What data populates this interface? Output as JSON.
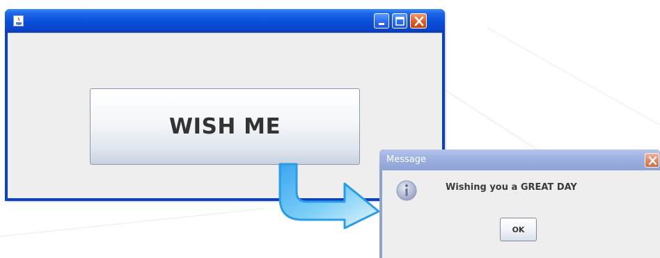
{
  "main_window": {
    "title": "",
    "icons": {
      "app": "java-app-icon",
      "minimize": "minimize-icon",
      "maximize": "maximize-icon",
      "close": "close-icon"
    },
    "button_label": "WISH ME"
  },
  "arrow": {
    "icon": "curved-arrow-icon"
  },
  "message_dialog": {
    "title": "Message",
    "icon": "info-icon",
    "text": "Wishing you a GREAT DAY",
    "ok_label": "OK",
    "close_icon": "close-icon"
  },
  "colors": {
    "titlebar_blue": "#0a4fd8",
    "close_orange": "#e0602c",
    "inactive_titlebar": "#9eb1e0",
    "client_gray": "#eeeeee",
    "arrow_cyan": "#3ab4f2"
  }
}
